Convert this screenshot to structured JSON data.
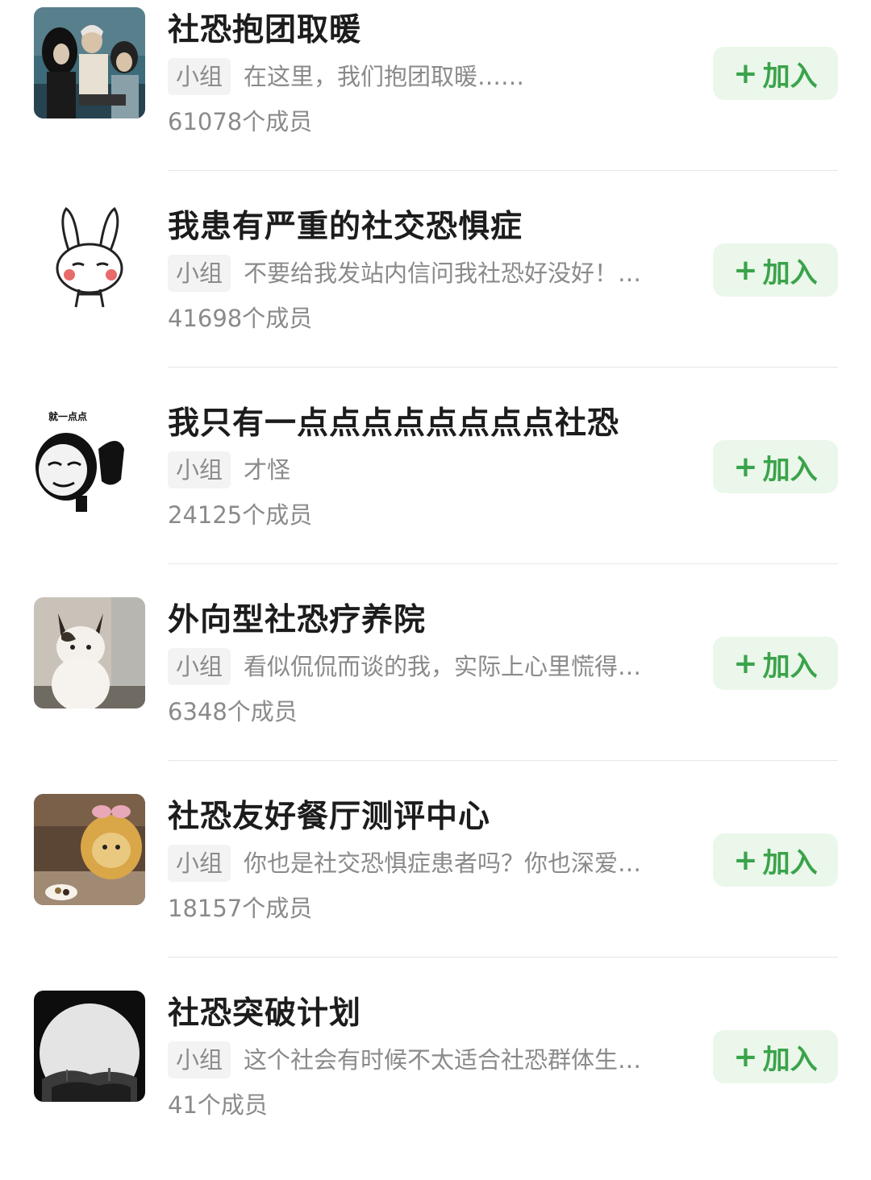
{
  "groups": [
    {
      "title": "社恐抱团取暖",
      "tag": "小组",
      "description": "在这里，我们抱团取暖……",
      "members": "61078个成员",
      "join_label": "加入",
      "join_icon": "plus-icon",
      "avatar": "couple-photo-avatar"
    },
    {
      "title": "我患有严重的社交恐惧症",
      "tag": "小组",
      "description": "不要给我发站内信问我社恐好没好！…",
      "members": "41698个成员",
      "join_label": "加入",
      "join_icon": "plus-icon",
      "avatar": "bunny-sticker-avatar"
    },
    {
      "title": "我只有一点点点点点点点点社恐",
      "tag": "小组",
      "description": "才怪",
      "members": "24125个成员",
      "join_label": "加入",
      "join_icon": "plus-icon",
      "avatar": "panda-meme-avatar",
      "avatar_caption": "就一点点"
    },
    {
      "title": "外向型社恐疗养院",
      "tag": "小组",
      "description": "看似侃侃而谈的我，实际上心里慌得…",
      "members": "6348个成员",
      "join_label": "加入",
      "join_icon": "plus-icon",
      "avatar": "cat-photo-avatar"
    },
    {
      "title": "社恐友好餐厅测评中心",
      "tag": "小组",
      "description": "你也是社交恐惧症患者吗？你也深爱…",
      "members": "18157个成员",
      "join_label": "加入",
      "join_icon": "plus-icon",
      "avatar": "teddy-bear-avatar"
    },
    {
      "title": "社恐突破计划",
      "tag": "小组",
      "description": "这个社会有时候不太适合社恐群体生…",
      "members": "41个成员",
      "join_label": "加入",
      "join_icon": "plus-icon",
      "avatar": "landscape-circle-avatar"
    }
  ],
  "colors": {
    "accent_green": "#3aa34a",
    "button_bg": "#eaf7ea",
    "tag_bg": "#f3f3f3",
    "muted_text": "#8a8a8a"
  }
}
